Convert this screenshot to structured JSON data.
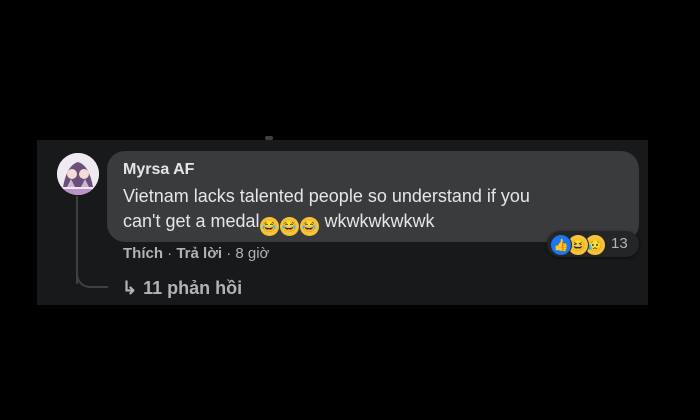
{
  "comment": {
    "author": "Myrsa AF",
    "text_line1": "Vietnam lacks talented people so understand if you",
    "text_line2_prefix": "can't get a medal",
    "text_line2_suffix": " wkwkwkwkwk",
    "emoji_in_text": [
      "rolling-on-floor-laughing",
      "rolling-on-floor-laughing",
      "rolling-on-floor-laughing"
    ]
  },
  "actions": {
    "like_label": "Thích",
    "separator": "·",
    "reply_label": "Trả lời",
    "time": "8 giờ"
  },
  "reactions": {
    "icons": [
      "like",
      "haha",
      "sad"
    ],
    "count": "13"
  },
  "replies": {
    "arrow": "↳",
    "label": "11 phản hồi"
  },
  "colors": {
    "background": "#000000",
    "panel": "#18191a",
    "bubble": "#3a3b3c",
    "text_primary": "#e4e6eb",
    "text_secondary": "#b0b3b8",
    "like_blue": "#1877f2",
    "emoji_yellow": "#f7c33a"
  }
}
